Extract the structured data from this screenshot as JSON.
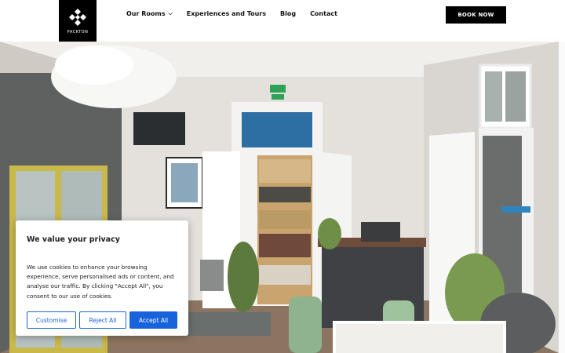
{
  "header": {
    "logo_text": "PACKTON",
    "nav": [
      {
        "label": "Our Rooms",
        "has_dropdown": true
      },
      {
        "label": "Experiences and Tours",
        "has_dropdown": false
      },
      {
        "label": "Blog",
        "has_dropdown": false
      },
      {
        "label": "Contact",
        "has_dropdown": false
      }
    ],
    "book_button": "BOOK NOW"
  },
  "cookie_banner": {
    "title": "We value your privacy",
    "body": "We use cookies to enhance your browsing experience, serve personalised ads or content, and analyse our traffic. By clicking \"Accept All\", you consent to our use of cookies.",
    "buttons": {
      "customise": "Customise",
      "reject": "Reject All",
      "accept": "Accept All"
    }
  },
  "colors": {
    "accent": "#1863dc",
    "header_bg": "#ffffff",
    "logo_bg": "#000000"
  }
}
